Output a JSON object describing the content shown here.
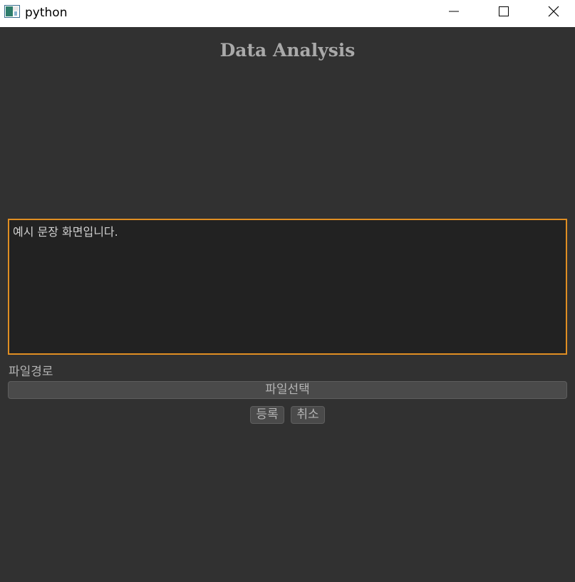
{
  "window": {
    "title": "python",
    "icon": "python-app-icon",
    "controls": [
      "minimize-icon",
      "maximize-icon",
      "close-icon"
    ]
  },
  "main": {
    "heading": "Data Analysis",
    "text_area_value": "예시 문장 화면입니다.",
    "file_path_label": "파일경로",
    "file_select_button": "파일선택",
    "register_button": "등록",
    "cancel_button": "취소"
  },
  "colors": {
    "background": "#313131",
    "text_area_background": "#222222",
    "focus_border": "#e08e22",
    "button_background": "#4a4a4a",
    "heading": "#a9a9a9"
  }
}
